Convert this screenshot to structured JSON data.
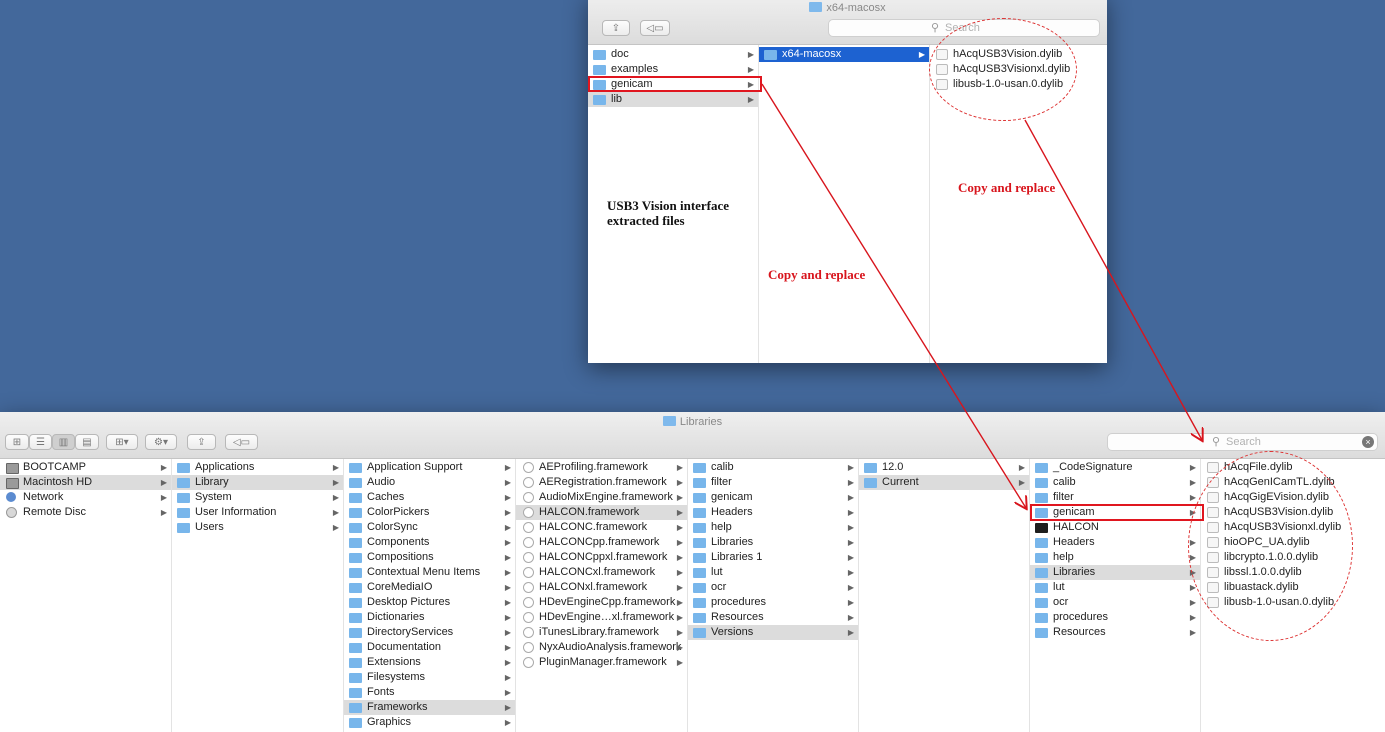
{
  "top_window": {
    "title": "x64-macosx",
    "search_placeholder": "Search",
    "col1": [
      {
        "label": "doc",
        "icon": "folder-icon",
        "arrow": "▶"
      },
      {
        "label": "examples",
        "icon": "folder-icon",
        "arrow": "▶"
      },
      {
        "label": "genicam",
        "icon": "folder-icon",
        "arrow": "▶"
      },
      {
        "label": "lib",
        "icon": "folder-icon",
        "arrow": "▶"
      }
    ],
    "col2": [
      {
        "label": "x64-macosx",
        "icon": "folder-icon",
        "arrow": "▶"
      }
    ],
    "col3": [
      {
        "label": "hAcqUSB3Vision.dylib",
        "icon": "dylib-file-icon"
      },
      {
        "label": "hAcqUSB3Visionxl.dylib",
        "icon": "dylib-file-icon"
      },
      {
        "label": "libusb-1.0-usan.0.dylib",
        "icon": "dylib-file-icon"
      }
    ]
  },
  "bottom_window": {
    "title": "Libraries",
    "search_placeholder": "Search",
    "col1": [
      {
        "label": "BOOTCAMP",
        "icon": "hard-disk-icon",
        "arrow": "▶"
      },
      {
        "label": "Macintosh HD",
        "icon": "hard-disk-icon",
        "arrow": "▶"
      },
      {
        "label": "Network",
        "icon": "network-globe-icon",
        "arrow": "▶"
      },
      {
        "label": "Remote Disc",
        "icon": "remote-disc-icon",
        "arrow": "▶"
      }
    ],
    "col2": [
      {
        "label": "Applications",
        "icon": "folder-icon",
        "arrow": "▶"
      },
      {
        "label": "Library",
        "icon": "folder-icon",
        "arrow": "▶"
      },
      {
        "label": "System",
        "icon": "folder-icon",
        "arrow": "▶"
      },
      {
        "label": "User Information",
        "icon": "folder-icon",
        "arrow": "▶"
      },
      {
        "label": "Users",
        "icon": "folder-icon",
        "arrow": "▶"
      }
    ],
    "col3": [
      {
        "label": "Application Support",
        "arrow": "▶"
      },
      {
        "label": "Audio",
        "arrow": "▶"
      },
      {
        "label": "Caches",
        "arrow": "▶"
      },
      {
        "label": "ColorPickers",
        "arrow": "▶"
      },
      {
        "label": "ColorSync",
        "arrow": "▶"
      },
      {
        "label": "Components",
        "arrow": "▶"
      },
      {
        "label": "Compositions",
        "arrow": "▶"
      },
      {
        "label": "Contextual Menu Items",
        "arrow": "▶"
      },
      {
        "label": "CoreMediaIO",
        "arrow": "▶"
      },
      {
        "label": "Desktop Pictures",
        "arrow": "▶"
      },
      {
        "label": "Dictionaries",
        "arrow": "▶"
      },
      {
        "label": "DirectoryServices",
        "arrow": "▶"
      },
      {
        "label": "Documentation",
        "arrow": "▶"
      },
      {
        "label": "Extensions",
        "arrow": "▶"
      },
      {
        "label": "Filesystems",
        "arrow": "▶"
      },
      {
        "label": "Fonts",
        "arrow": "▶"
      },
      {
        "label": "Frameworks",
        "arrow": "▶"
      },
      {
        "label": "Graphics",
        "arrow": "▶"
      }
    ],
    "col4": [
      {
        "label": "AEProfiling.framework",
        "arrow": "▶"
      },
      {
        "label": "AERegistration.framework",
        "arrow": "▶"
      },
      {
        "label": "AudioMixEngine.framework",
        "arrow": "▶"
      },
      {
        "label": "HALCON.framework",
        "arrow": "▶"
      },
      {
        "label": "HALCONC.framework",
        "arrow": "▶"
      },
      {
        "label": "HALCONCpp.framework",
        "arrow": "▶"
      },
      {
        "label": "HALCONCppxl.framework",
        "arrow": "▶"
      },
      {
        "label": "HALCONCxl.framework",
        "arrow": "▶"
      },
      {
        "label": "HALCONxl.framework",
        "arrow": "▶"
      },
      {
        "label": "HDevEngineCpp.framework",
        "arrow": "▶"
      },
      {
        "label": "HDevEngine…xl.framework",
        "arrow": "▶"
      },
      {
        "label": "iTunesLibrary.framework",
        "arrow": "▶"
      },
      {
        "label": "NyxAudioAnalysis.framework",
        "arrow": "▶"
      },
      {
        "label": "PluginManager.framework",
        "arrow": "▶"
      }
    ],
    "col5": [
      {
        "label": "calib",
        "arrow": "▶"
      },
      {
        "label": "filter",
        "arrow": "▶"
      },
      {
        "label": "genicam",
        "arrow": "▶"
      },
      {
        "label": "Headers",
        "arrow": "▶"
      },
      {
        "label": "help",
        "arrow": "▶"
      },
      {
        "label": "Libraries",
        "arrow": "▶"
      },
      {
        "label": "Libraries 1",
        "arrow": "▶"
      },
      {
        "label": "lut",
        "arrow": "▶"
      },
      {
        "label": "ocr",
        "arrow": "▶"
      },
      {
        "label": "procedures",
        "arrow": "▶"
      },
      {
        "label": "Resources",
        "arrow": "▶"
      },
      {
        "label": "Versions",
        "arrow": "▶"
      }
    ],
    "col6": [
      {
        "label": "12.0",
        "arrow": "▶"
      },
      {
        "label": "Current",
        "arrow": "▶"
      }
    ],
    "col7": [
      {
        "label": "_CodeSignature",
        "arrow": "▶"
      },
      {
        "label": "calib",
        "arrow": "▶"
      },
      {
        "label": "filter",
        "arrow": "▶"
      },
      {
        "label": "genicam",
        "arrow": "▶"
      },
      {
        "label": "HALCON",
        "arrow": ""
      },
      {
        "label": "Headers",
        "arrow": "▶"
      },
      {
        "label": "help",
        "arrow": "▶"
      },
      {
        "label": "Libraries",
        "arrow": "▶"
      },
      {
        "label": "lut",
        "arrow": "▶"
      },
      {
        "label": "ocr",
        "arrow": "▶"
      },
      {
        "label": "procedures",
        "arrow": "▶"
      },
      {
        "label": "Resources",
        "arrow": "▶"
      }
    ],
    "col8": [
      {
        "label": "hAcqFile.dylib"
      },
      {
        "label": "hAcqGenICamTL.dylib"
      },
      {
        "label": "hAcqGigEVision.dylib"
      },
      {
        "label": "hAcqUSB3Vision.dylib"
      },
      {
        "label": "hAcqUSB3Visionxl.dylib"
      },
      {
        "label": "hioOPC_UA.dylib"
      },
      {
        "label": "libcrypto.1.0.0.dylib"
      },
      {
        "label": "libssl.1.0.0.dylib"
      },
      {
        "label": "libuastack.dylib"
      },
      {
        "label": "libusb-1.0-usan.0.dylib"
      }
    ]
  },
  "annotations": {
    "extracted_note": "USB3 Vision interface\nextracted files",
    "copy_replace_1": "Copy and replace",
    "copy_replace_2": "Copy and replace",
    "accent_color": "#d8151d"
  }
}
